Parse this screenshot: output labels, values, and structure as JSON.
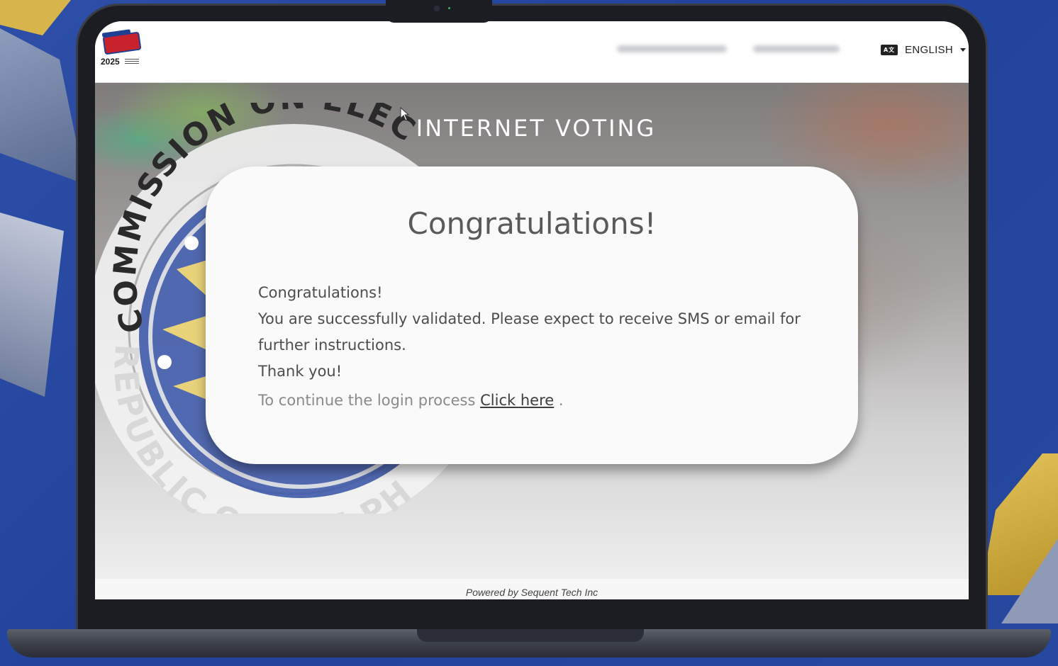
{
  "header": {
    "logo": {
      "year": "2025"
    },
    "language": {
      "label": "ENGLISH",
      "icon": "language-icon",
      "icon_text": "A文"
    }
  },
  "hero": {
    "title": "INTERNET VOTING",
    "seal": {
      "top_text": "COMMISSION ON ELEC",
      "bottom_text": "REPUBLIC OF THE PH"
    }
  },
  "dialog": {
    "title": "Congratulations!",
    "messages": [
      "Congratulations!",
      "You are successfully validated. Please expect to receive SMS or email for further instructions.",
      "Thank you!"
    ],
    "continue_prefix": "To continue the login process",
    "continue_link": "Click here",
    "continue_suffix": " ."
  },
  "footer": {
    "powered_by": "Powered by Sequent Tech Inc"
  },
  "colors": {
    "background": "#21439b",
    "card": "#fafafa",
    "title_text": "#5a5a5a"
  }
}
